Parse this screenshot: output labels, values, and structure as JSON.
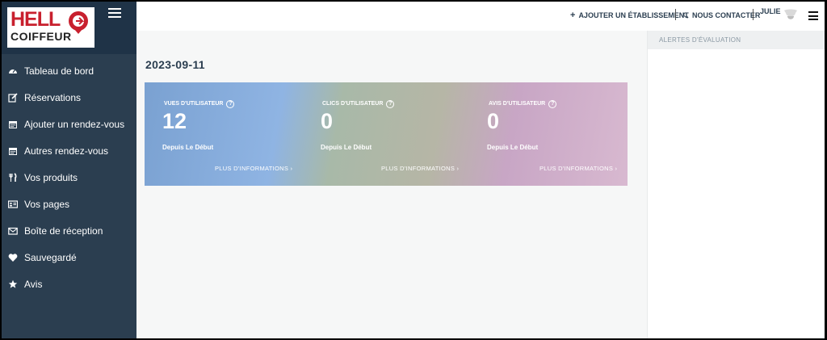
{
  "brand": {
    "logo_line1": "HELL",
    "logo_line2": "COIFFEUR",
    "accent": "#c8202e"
  },
  "sidebar": {
    "items": [
      {
        "label": "Tableau de bord",
        "icon": "dashboard-icon"
      },
      {
        "label": "Réservations",
        "icon": "edit-icon"
      },
      {
        "label": "Ajouter un rendez-vous",
        "icon": "calendar-icon"
      },
      {
        "label": "Autres rendez-vous",
        "icon": "calendar-icon"
      },
      {
        "label": "Vos produits",
        "icon": "cutlery-icon"
      },
      {
        "label": "Vos pages",
        "icon": "id-card-icon"
      },
      {
        "label": "Boîte de réception",
        "icon": "envelope-icon"
      },
      {
        "label": "Sauvegardé",
        "icon": "heart-icon"
      },
      {
        "label": "Avis",
        "icon": "star-icon"
      }
    ]
  },
  "topbar": {
    "add_label": "AJOUTER UN ÉTABLISSEMENT",
    "contact_label": "NOUS CONTACTER",
    "user_name": "JULIE"
  },
  "main": {
    "date": "2023-09-11",
    "cards": [
      {
        "label": "VUES D'UTILISATEUR",
        "value": "12",
        "since": "Depuis Le Début",
        "more": "PLUS D'INFORMATIONS  ›"
      },
      {
        "label": "CLICS D'UTILISATEUR",
        "value": "0",
        "since": "Depuis Le Début",
        "more": "PLUS D'INFORMATIONS  ›"
      },
      {
        "label": "AVIS D'UTILISATEUR",
        "value": "0",
        "since": "Depuis Le Début",
        "more": "PLUS D'INFORMATIONS  ›"
      }
    ],
    "help_glyph": "?"
  },
  "right_panel": {
    "title": "ALERTES D'ÉVALUATION"
  }
}
